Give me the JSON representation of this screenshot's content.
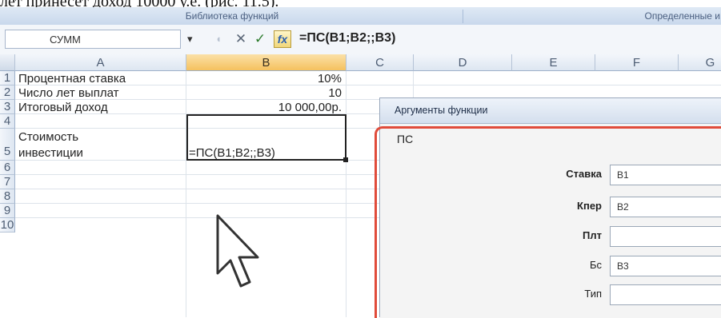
{
  "caption": "лет принесет доход 10000 у.е. (рис. 11.5).",
  "ribbon": {
    "group1": "Библиотека функций",
    "group2": "Определенные и"
  },
  "formula_bar": {
    "name_box": "СУММ",
    "dropdown_glyph": "▾",
    "cancel_glyph": "✕",
    "enter_glyph": "✓",
    "fx_label": "fx",
    "formula": "=ПС(B1;B2;;B3)"
  },
  "columns": [
    "A",
    "B",
    "C",
    "D",
    "E",
    "F",
    "G"
  ],
  "rows": [
    "1",
    "2",
    "3",
    "4",
    "5",
    "6",
    "7",
    "8",
    "9",
    "10"
  ],
  "cells": {
    "a1": "Процентная ставка",
    "b1": "10%",
    "a2": "Число лет выплат",
    "b2": "10",
    "a3": "Итоговый доход",
    "b3": "10 000,00р.",
    "a5_line1": "Стоимость",
    "a5_line2": "инвестиции",
    "b5": "=ПС(B1;B2;;B3)"
  },
  "dialog": {
    "title": "Аргументы функции",
    "function_name": "ПС",
    "args": [
      {
        "label": "Ставка",
        "value": "B1",
        "bold": true
      },
      {
        "label": "Кпер",
        "value": "B2",
        "bold": true
      },
      {
        "label": "Плт",
        "value": "",
        "bold": true
      },
      {
        "label": "Бс",
        "value": "B3",
        "bold": false
      },
      {
        "label": "Тип",
        "value": "",
        "bold": false
      }
    ]
  },
  "colors": {
    "highlight_border": "#e04b3a",
    "selected_column": "#f5c15e"
  }
}
